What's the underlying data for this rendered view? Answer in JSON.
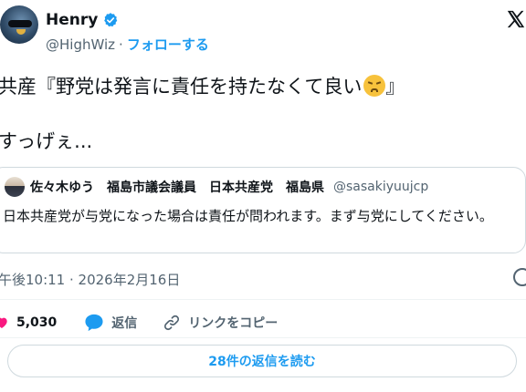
{
  "author": {
    "display_name": "Henry",
    "handle": "@HighWiz",
    "separator": "·",
    "follow_label": "フォローする",
    "verified_icon": "verified-badge-icon",
    "colors": {
      "accent": "#1d9bf0",
      "secondary_text": "#536471"
    }
  },
  "tweet": {
    "line1": "共産『野党は発言に責任を持たなくて良い",
    "line1_end": "』",
    "emoji": "angry-face-emoji",
    "line2": "すっげぇ..."
  },
  "quote": {
    "name": "佐々木ゆう　福島市議会議員　日本共産党　福島県",
    "handle": "@sasakiyuujcp",
    "text": "日本共産党が与党になった場合は責任が問われます。まず与党にしてください。"
  },
  "meta": {
    "timestamp": "午後10:11 · 2026年2月16日"
  },
  "actions": {
    "like_count": "5,030",
    "reply_label": "返信",
    "copy_link_label": "リンクをコピー",
    "like_color": "#f91880"
  },
  "replies_button": {
    "label": "28件の返信を読む"
  }
}
